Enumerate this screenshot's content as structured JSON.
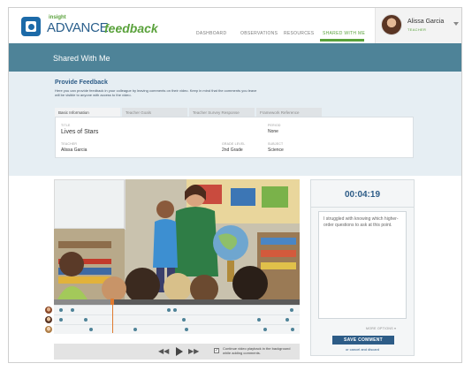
{
  "app": {
    "logo_prefix": "insight",
    "logo_main": "ADVANCE",
    "logo_suffix": "feedback"
  },
  "nav": {
    "items": [
      {
        "label": "DASHBOARD",
        "active": false
      },
      {
        "label": "OBSERVATIONS",
        "active": false
      },
      {
        "label": "RESOURCES",
        "active": false
      },
      {
        "label": "SHARED WITH ME",
        "active": true
      }
    ]
  },
  "user": {
    "name": "Alissa Garcia",
    "role": "TEACHER"
  },
  "page": {
    "title": "Shared With Me"
  },
  "feedback": {
    "title": "Provide Feedback",
    "description": "Here you can provide feedback in your colleague by leaving comments on their video. Keep in mind that the comments you leave will be visible to anyone with access to the video."
  },
  "tabs": [
    {
      "label": "Basic Information",
      "active": true
    },
    {
      "label": "Teacher Goals",
      "active": false
    },
    {
      "label": "Teacher Survey Response",
      "active": false
    },
    {
      "label": "Framework Reference",
      "active": false
    }
  ],
  "info": {
    "title_label": "TITLE",
    "title_value": "Lives of Stars",
    "teacher_label": "TEACHER",
    "teacher_value": "Alissa Garcia",
    "grade_label": "GRADE LEVEL",
    "grade_value": "2nd Grade",
    "period_label": "PERIOD",
    "period_value": "None",
    "subject_label": "SUBJECT",
    "subject_value": "Science"
  },
  "player": {
    "rewind_label": "◀◀",
    "forward_label": "▶▶",
    "continuous_label": "Continue video playback in the background while adding comments.",
    "continuous_checked": true
  },
  "comment": {
    "timestamp": "00:04:19",
    "text": "I struggled with knowing which higher-order questions to ask at this point.",
    "more_options": "MORE OPTIONS",
    "save_label": "SAVE COMMENT",
    "cancel_label": "or cancel and discard"
  },
  "colors": {
    "accent_green": "#5aa23c",
    "brand_blue": "#2d5c87",
    "header_teal": "#4e8398",
    "playhead_orange": "#e07a2f"
  }
}
